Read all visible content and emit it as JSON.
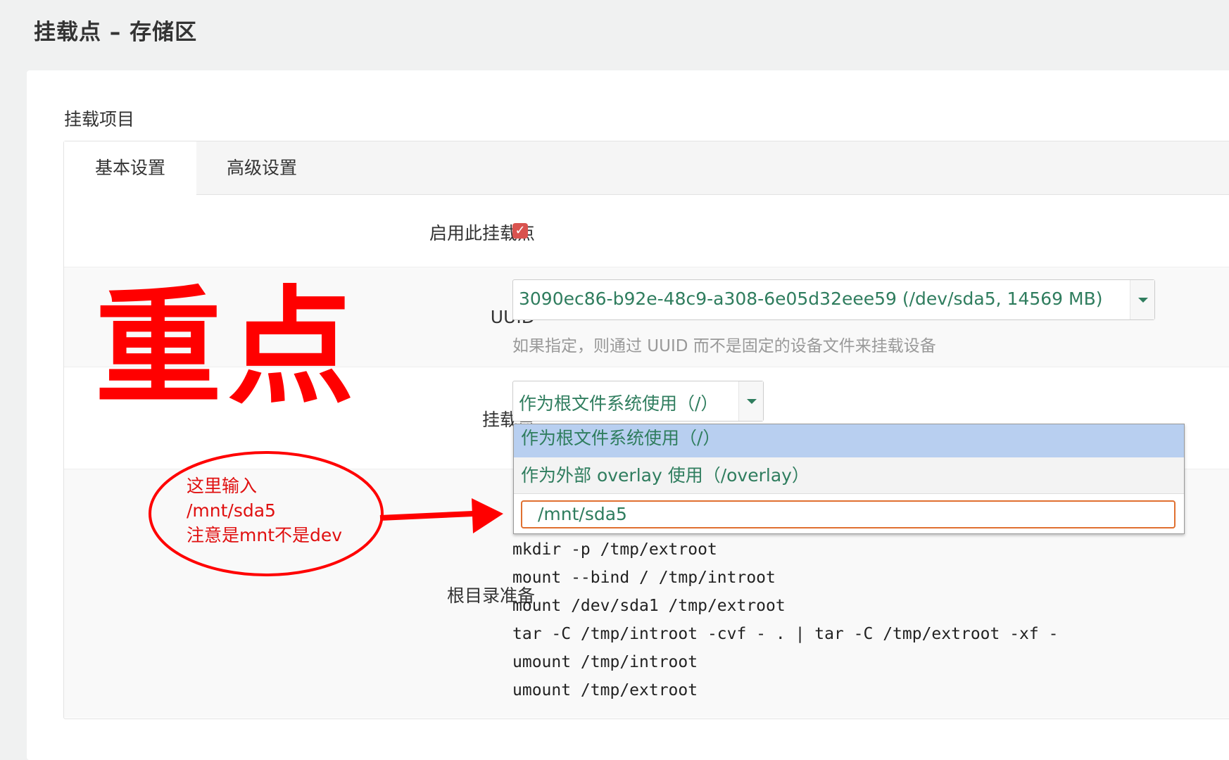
{
  "page": {
    "title": "挂载点 – 存储区"
  },
  "section": {
    "title": "挂载项目"
  },
  "tabs": [
    {
      "label": "基本设置",
      "active": true
    },
    {
      "label": "高级设置",
      "active": false
    }
  ],
  "fields": {
    "enable": {
      "label": "启用此挂载点",
      "checked": true
    },
    "uuid": {
      "label": "UUID",
      "value": "3090ec86-b92e-48c9-a308-6e05d32eee59 (/dev/sda5, 14569 MB)",
      "help": "如果指定，则通过 UUID 而不是固定的设备文件来挂载设备"
    },
    "mountpoint": {
      "label": "挂载点",
      "value": "作为根文件系统使用（/）",
      "options": [
        "作为根文件系统使用（/）",
        "作为外部 overlay 使用（/overlay）"
      ],
      "custom_value": "/mnt/sda5"
    },
    "root_prep": {
      "label": "根目录准备",
      "code": [
        "mkdir -p /tmp/extroot",
        "mount --bind / /tmp/introot",
        "mount /dev/sda1 /tmp/extroot",
        "tar -C /tmp/introot -cvf - . | tar -C /tmp/extroot -xf -",
        "umount /tmp/introot",
        "umount /tmp/extroot"
      ]
    }
  },
  "annotation": {
    "big_text": "重点",
    "note_lines": [
      "这里输入",
      "/mnt/sda5",
      "注意是mnt不是dev"
    ],
    "color": "#ff0000"
  },
  "colors": {
    "value_text": "#2f7d5e",
    "checkbox": "#d9534f",
    "focus_border": "#e07030"
  }
}
